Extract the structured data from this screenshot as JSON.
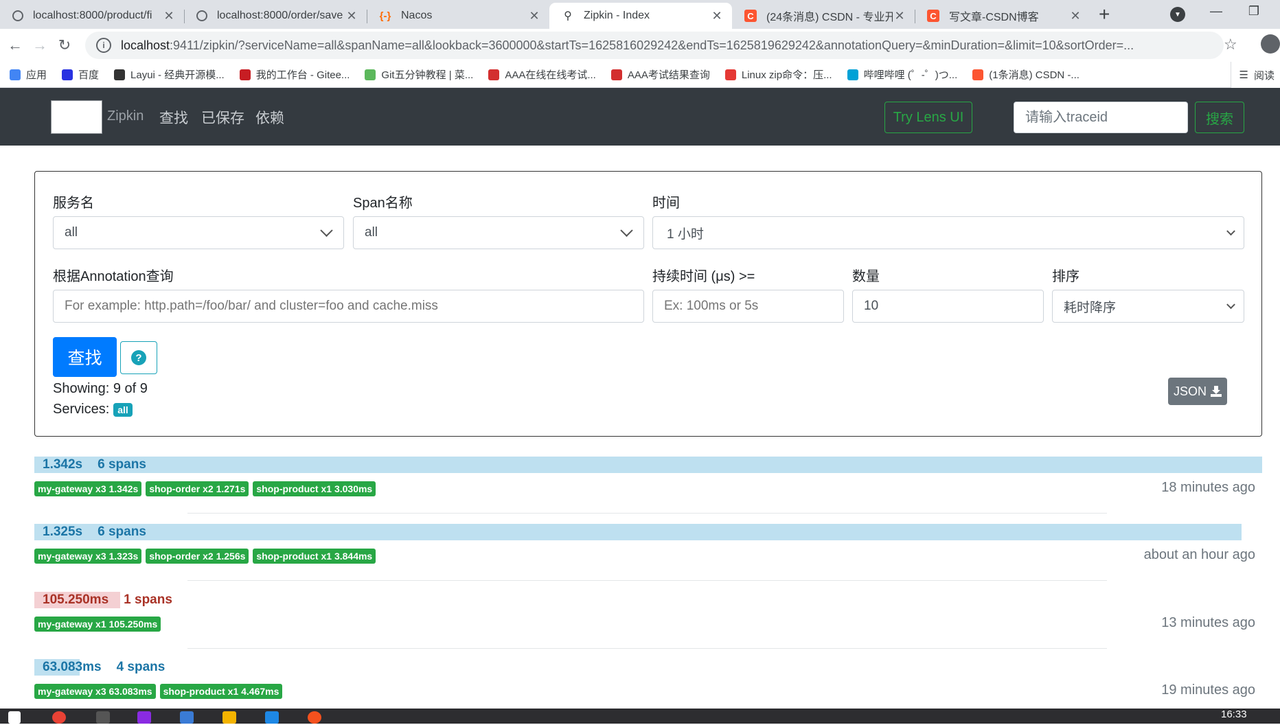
{
  "browser": {
    "tabs": [
      {
        "title": "localhost:8000/product/fi",
        "icon": "globe-icon"
      },
      {
        "title": "localhost:8000/order/save",
        "icon": "globe-icon"
      },
      {
        "title": "Nacos",
        "icon": "nacos-icon"
      },
      {
        "title": "Zipkin - Index",
        "icon": "zipkin-icon",
        "active": true
      },
      {
        "title": "(24条消息) CSDN - 专业开",
        "icon": "csdn-icon"
      },
      {
        "title": "写文章-CSDN博客",
        "icon": "csdn-icon"
      }
    ],
    "url_host": "localhost",
    "url_rest": ":9411/zipkin/?serviceName=all&spanName=all&lookback=3600000&startTs=1625816029242&endTs=1625819629242&annotationQuery=&minDuration=&limit=10&sortOrder=...",
    "bookmarks": [
      {
        "label": "应用",
        "color": "#4285f4"
      },
      {
        "label": "百度",
        "color": "#2932e1"
      },
      {
        "label": "Layui - 经典开源模...",
        "color": "#333333"
      },
      {
        "label": "我的工作台 - Gitee...",
        "color": "#c71d23"
      },
      {
        "label": "Git五分钟教程 | 菜...",
        "color": "#5cb85c"
      },
      {
        "label": "AAA在线在线考试...",
        "color": "#d32f2f"
      },
      {
        "label": "AAA考试结果查询",
        "color": "#d32f2f"
      },
      {
        "label": "Linux zip命令：压...",
        "color": "#e53935"
      },
      {
        "label": "哔哩哔哩 (゜-゜)つ...",
        "color": "#00a1d6"
      },
      {
        "label": "(1条消息) CSDN -...",
        "color": "#fc5531"
      }
    ],
    "reading_list": "阅读"
  },
  "header": {
    "brand": "Zipkin",
    "nav": [
      "查找",
      "已保存",
      "依赖"
    ],
    "lens_button": "Try Lens UI",
    "traceid_placeholder": "请输入traceid",
    "search_button": "搜索"
  },
  "form": {
    "service_label": "服务名",
    "service_value": "all",
    "span_label": "Span名称",
    "span_value": "all",
    "time_label": "时间",
    "time_value": "1 小时",
    "annotation_label": "根据Annotation查询",
    "annotation_placeholder": "For example: http.path=/foo/bar/ and cluster=foo and cache.miss",
    "duration_label": "持续时间 (μs) >=",
    "duration_placeholder": "Ex: 100ms or 5s",
    "limit_label": "数量",
    "limit_value": "10",
    "sort_label": "排序",
    "sort_value": "耗时降序",
    "find_button": "查找",
    "help_icon": "?",
    "showing": "Showing: 9 of 9",
    "services_label": "Services:",
    "services_badge": "all",
    "json_button": "JSON"
  },
  "traces": [
    {
      "duration": "1.342s",
      "spans": "6 spans",
      "fill": 1.0,
      "bar_color": "#bee0f0",
      "text_color": "#1b75a6",
      "tags": [
        "my-gateway x3 1.342s",
        "shop-order x2 1.271s",
        "shop-product x1 3.030ms"
      ],
      "ago": "18 minutes ago"
    },
    {
      "duration": "1.325s",
      "spans": "6 spans",
      "fill": 0.983,
      "bar_color": "#bee0f0",
      "text_color": "#1b75a6",
      "tags": [
        "my-gateway x3 1.323s",
        "shop-order x2 1.256s",
        "shop-product x1 3.844ms"
      ],
      "ago": "about an hour ago"
    },
    {
      "duration": "105.250ms",
      "spans": "1 spans",
      "fill": 0.07,
      "bar_color": "#f4d0d3",
      "text_color": "#a93226",
      "tags": [
        "my-gateway x1 105.250ms"
      ],
      "ago": "13 minutes ago"
    },
    {
      "duration": "63.083ms",
      "spans": "4 spans",
      "fill": 0.037,
      "bar_color": "#bee0f0",
      "text_color": "#1b75a6",
      "tags": [
        "my-gateway x3 63.083ms",
        "shop-product x1 4.467ms"
      ],
      "ago": "19 minutes ago"
    }
  ],
  "taskbar": {
    "clock": "16:33"
  }
}
